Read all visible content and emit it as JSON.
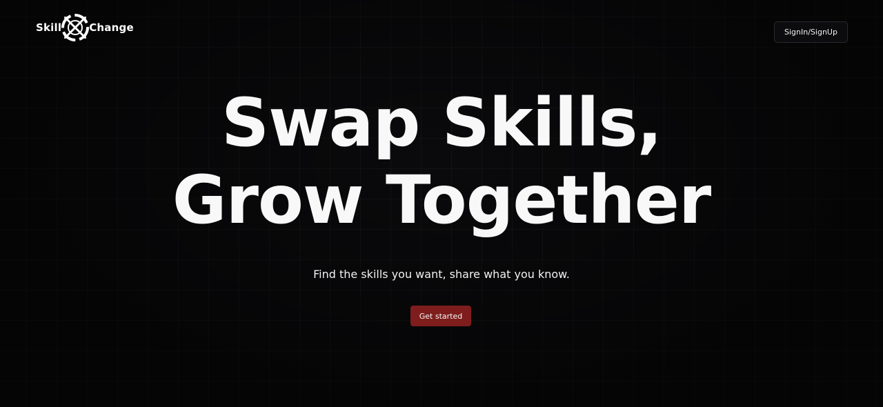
{
  "header": {
    "logo": {
      "text_left": "Skill",
      "text_right": "Change",
      "icon": "crossed-arrows-gear-icon"
    },
    "signin_label": "SignIn/SignUp"
  },
  "hero": {
    "title_line1": "Swap Skills,",
    "title_line2": "Grow Together",
    "subtitle": "Find the skills you want, share what you know.",
    "cta_label": "Get started"
  },
  "colors": {
    "background": "#0a0a0c",
    "accent": "#7f1d1d",
    "text": "#f8f8f8"
  }
}
